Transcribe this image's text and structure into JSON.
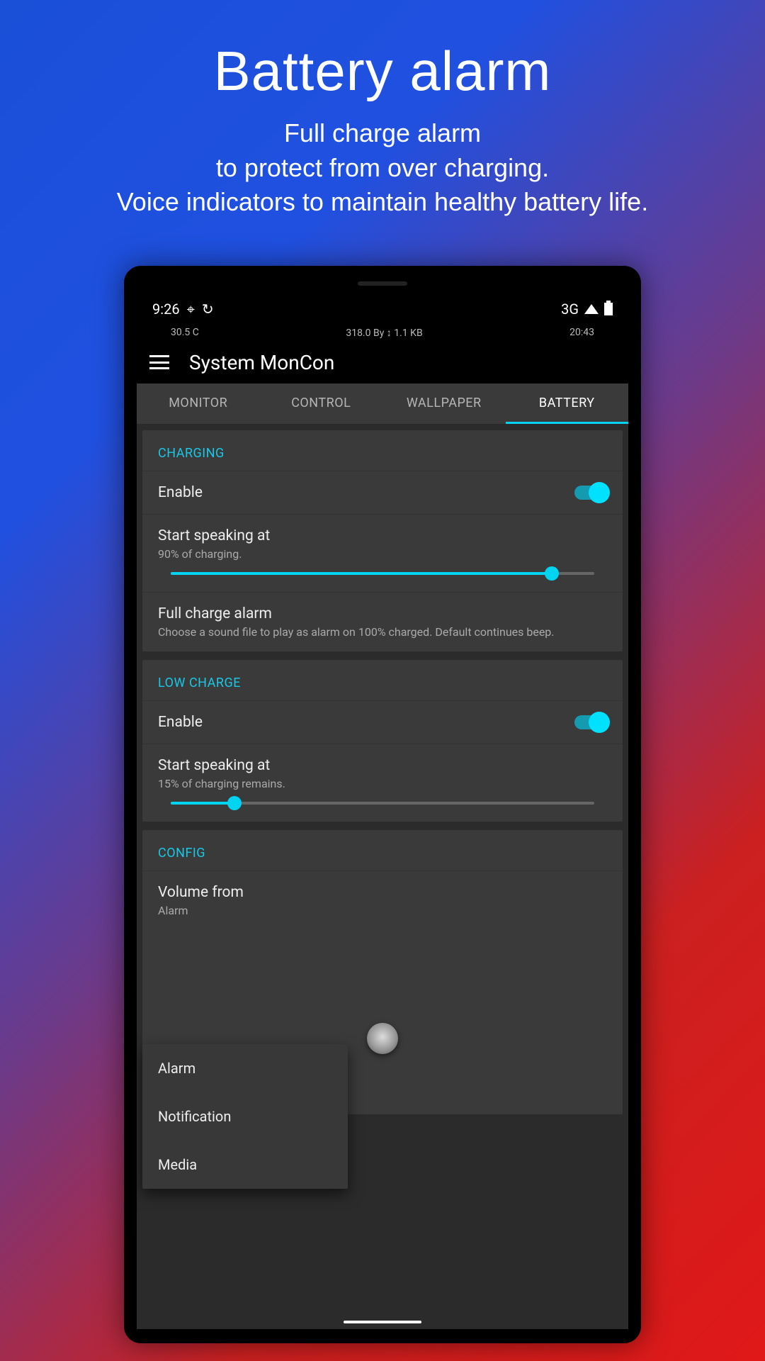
{
  "promo": {
    "title": "Battery alarm",
    "line1": "Full charge alarm",
    "line2": "to protect from over charging.",
    "line3": "Voice indicators to maintain healthy battery life."
  },
  "status": {
    "time": "9:26",
    "network": "3G"
  },
  "info": {
    "temp": "30.5 C",
    "data": "318.0 By ↕ 1.1 KB",
    "clock": "20:43"
  },
  "app": {
    "title": "System MonCon"
  },
  "tabs": {
    "monitor": "MONITOR",
    "control": "CONTROL",
    "wallpaper": "WALLPAPER",
    "battery": "BATTERY"
  },
  "charging": {
    "header": "CHARGING",
    "enable": "Enable",
    "speak_title": "Start speaking at",
    "speak_sub": "90% of charging.",
    "slider_pct": 90,
    "alarm_title": "Full charge alarm",
    "alarm_sub": "Choose a sound file to play as alarm on 100% charged. Default continues beep."
  },
  "low": {
    "header": "LOW CHARGE",
    "enable": "Enable",
    "speak_title": "Start speaking at",
    "speak_sub": "15% of charging remains.",
    "slider_pct": 15
  },
  "config": {
    "header": "CONFIG",
    "vol_title": "Volume from",
    "vol_sub": "Alarm",
    "options": {
      "alarm": "Alarm",
      "notification": "Notification",
      "media": "Media"
    }
  }
}
